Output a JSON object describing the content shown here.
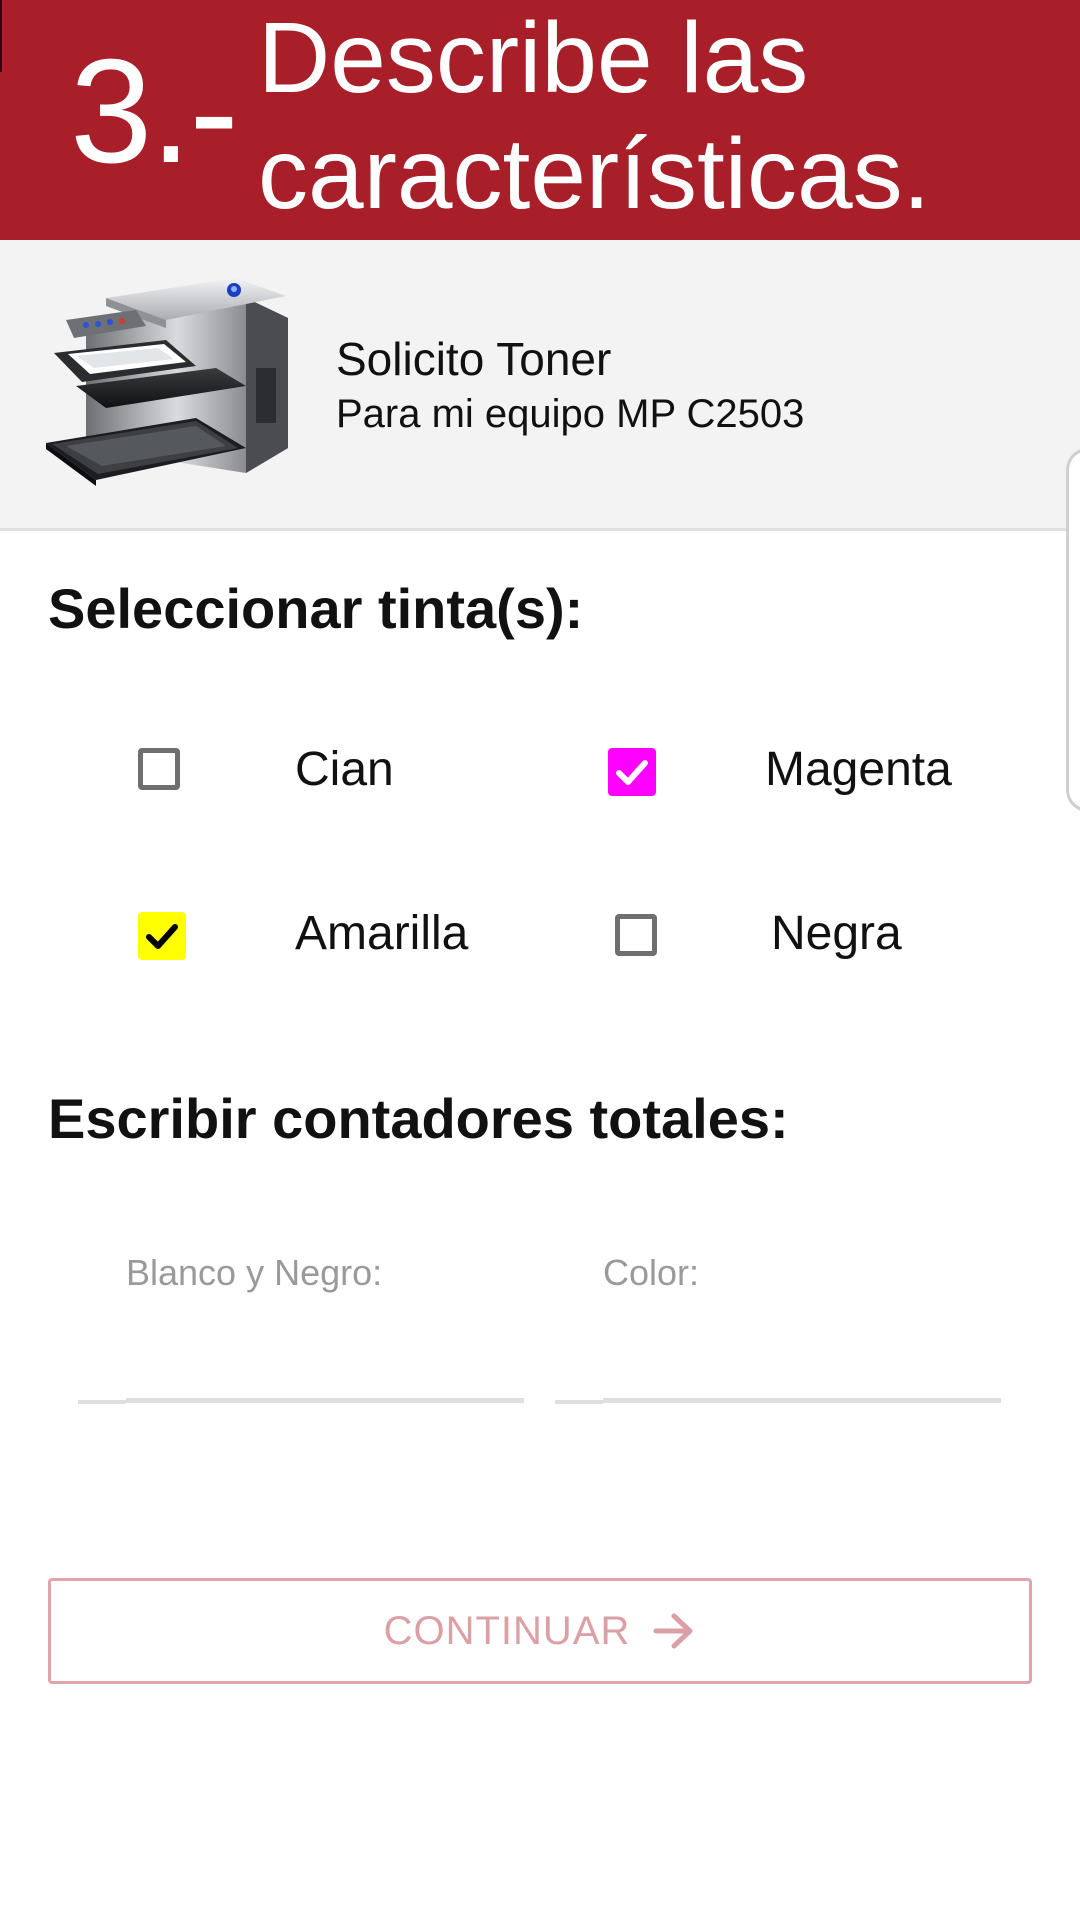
{
  "header": {
    "step_number": "3.-",
    "title": "Describe las características."
  },
  "product": {
    "icon": "printer-icon",
    "title": "Solicito Toner",
    "subtitle": "Para mi equipo MP C2503"
  },
  "inks": {
    "section_title": "Seleccionar tinta(s):",
    "options": [
      {
        "label": "Cian",
        "checked": false
      },
      {
        "label": "Magenta",
        "checked": true,
        "color": "#ff00ff"
      },
      {
        "label": "Amarilla",
        "checked": true,
        "color": "#ffff00"
      },
      {
        "label": "Negra",
        "checked": false
      }
    ]
  },
  "counters": {
    "section_title": "Escribir contadores totales:",
    "bw": {
      "label": "Blanco y Negro:",
      "value": ""
    },
    "color": {
      "label": "Color:",
      "value": ""
    }
  },
  "continue_button": {
    "label": "CONTINUAR",
    "icon": "arrow-right-icon"
  },
  "colors": {
    "header_bg": "#a81e29",
    "button_border": "#e2a4aa",
    "button_text": "#dba0a6"
  }
}
